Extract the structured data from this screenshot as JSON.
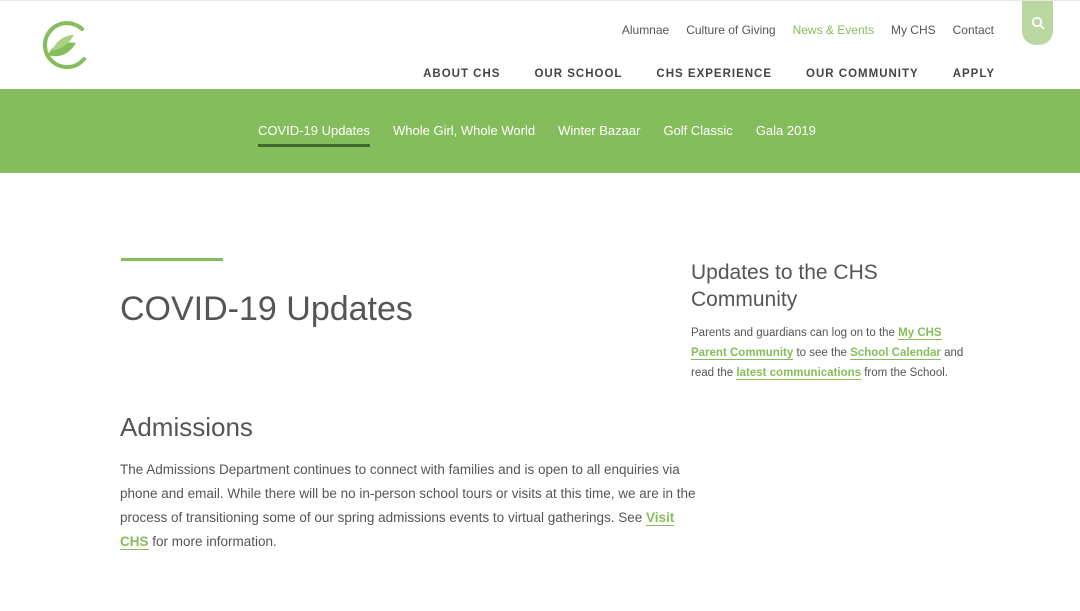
{
  "brand": {
    "accent": "#86bd5c",
    "accent_dark": "#3f6b2f",
    "logo_icon": "leaf-logo-icon"
  },
  "utility_nav": {
    "items": [
      "Alumnae",
      "Culture of Giving",
      "News & Events",
      "My CHS",
      "Contact"
    ],
    "active": "News & Events",
    "search_icon": "search-icon"
  },
  "main_nav": {
    "items": [
      "ABOUT CHS",
      "OUR SCHOOL",
      "CHS EXPERIENCE",
      "OUR COMMUNITY",
      "APPLY"
    ]
  },
  "sub_nav": {
    "items": [
      "COVID-19 Updates",
      "Whole Girl, Whole World",
      "Winter Bazaar",
      "Golf Classic",
      "Gala 2019"
    ],
    "current": "COVID-19 Updates"
  },
  "main": {
    "title": "COVID-19 Updates",
    "section": {
      "heading": "Admissions",
      "text_before": "The Admissions Department continues to connect with families and is open to all enquiries via phone and email. While there will be no in-person school tours or visits at this time, we are in the process of transitioning some of our spring admissions events to virtual gatherings. See ",
      "link": "Visit CHS",
      "text_after": " for more information."
    }
  },
  "sidebar": {
    "title": "Updates to the CHS Community",
    "p1": "Parents and guardians can log on to the ",
    "link1": "My CHS Parent Community",
    "p2": " to see the ",
    "link2": "School Calendar",
    "p3": " and read the ",
    "link3": "latest communications",
    "p4": " from the School."
  }
}
